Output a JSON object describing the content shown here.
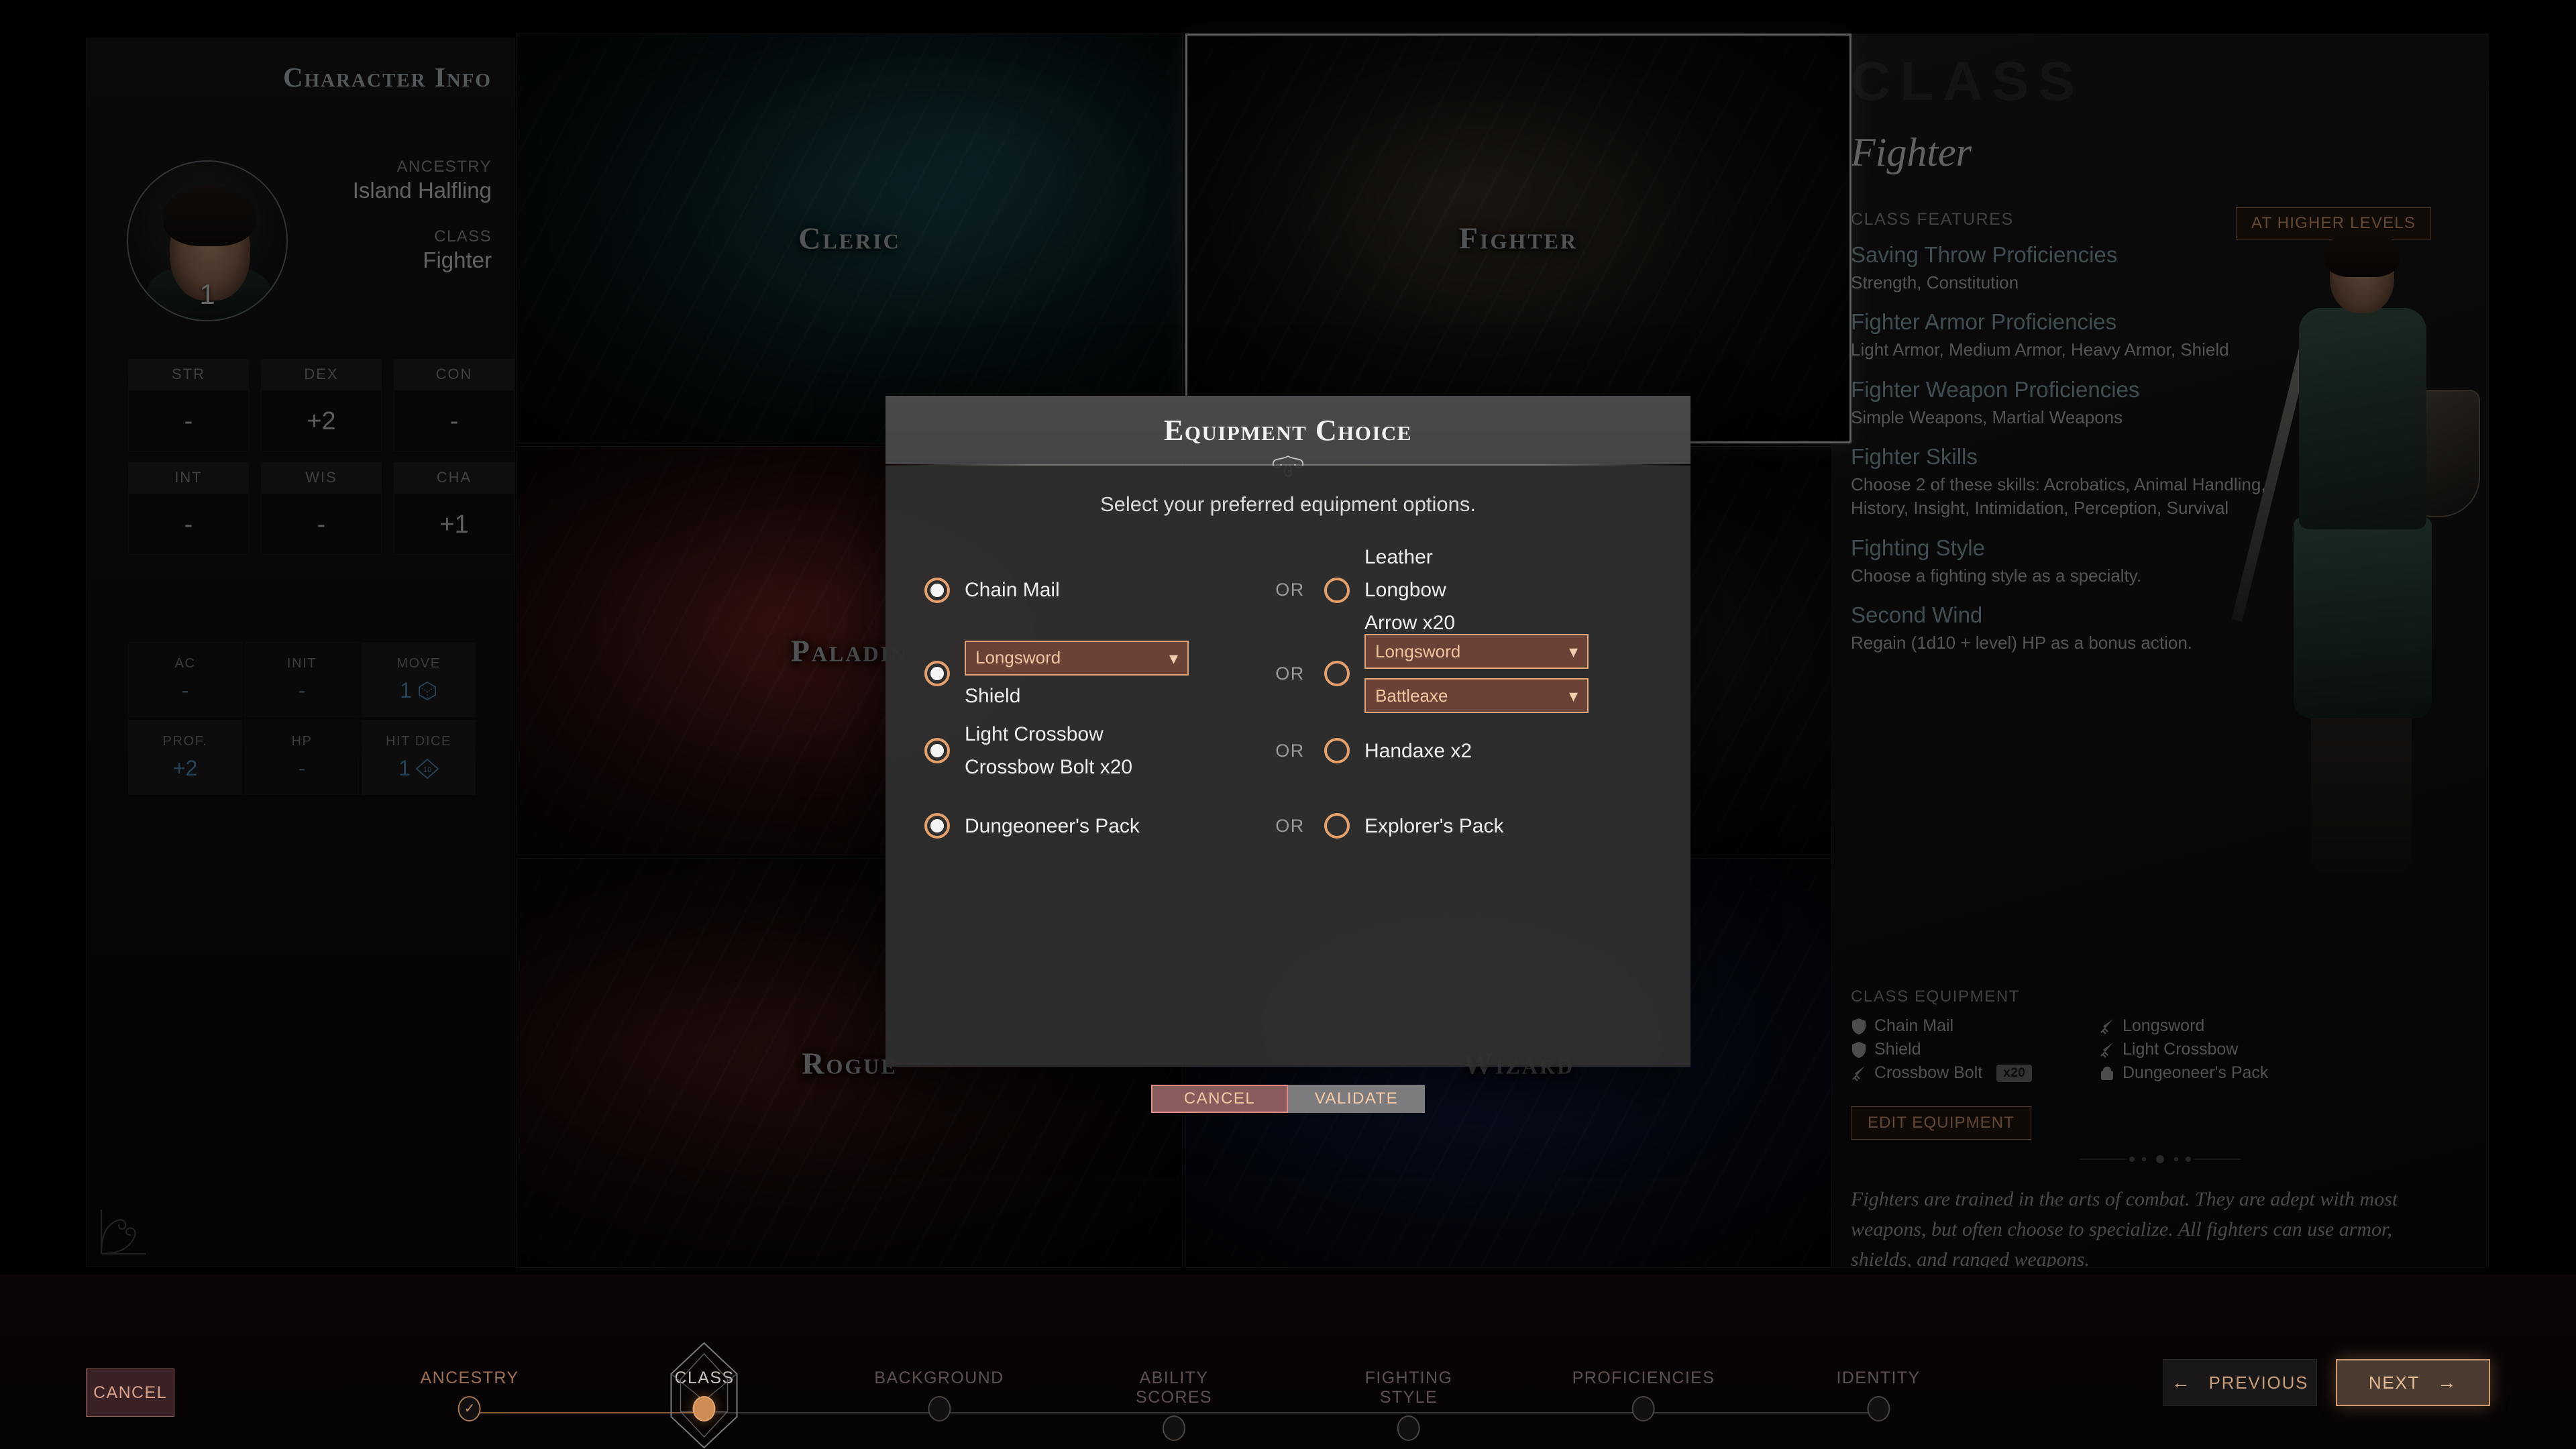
{
  "left_panel": {
    "heading": "Character Info",
    "portrait_level": "1",
    "ancestry_label": "ANCESTRY",
    "ancestry_value": "Island Halfling",
    "class_label": "CLASS",
    "class_value": "Fighter",
    "abilities": [
      {
        "name": "STR",
        "value": "-"
      },
      {
        "name": "DEX",
        "value": "+2"
      },
      {
        "name": "CON",
        "value": "-"
      },
      {
        "name": "INT",
        "value": "-"
      },
      {
        "name": "WIS",
        "value": "-"
      },
      {
        "name": "CHA",
        "value": "+1"
      }
    ],
    "derived": [
      {
        "name": "AC",
        "value": "-",
        "icon": "none",
        "highlight": false
      },
      {
        "name": "INIT",
        "value": "-",
        "icon": "none",
        "highlight": false
      },
      {
        "name": "MOVE",
        "value": "1",
        "icon": "cube",
        "highlight": true
      },
      {
        "name": "PROF.",
        "value": "+2",
        "icon": "none",
        "highlight": true
      },
      {
        "name": "HP",
        "value": "-",
        "icon": "none",
        "highlight": false
      },
      {
        "name": "HIT DICE",
        "value": "1",
        "icon": "d10",
        "highlight": true
      }
    ]
  },
  "class_grid": {
    "cards": [
      {
        "label": "Cleric",
        "key": "cleric",
        "selected": false
      },
      {
        "label": "Fighter",
        "key": "fighter",
        "selected": true
      },
      {
        "label": "Paladin",
        "key": "paladin",
        "selected": false
      },
      {
        "label": "",
        "key": "ranger",
        "selected": false
      },
      {
        "label": "Rogue",
        "key": "rogue",
        "selected": false
      },
      {
        "label": "Wizard",
        "key": "wizard",
        "selected": false
      }
    ]
  },
  "right_panel": {
    "ghost_title": "CLASS",
    "class_name": "Fighter",
    "features_heading": "CLASS FEATURES",
    "higher_levels_button": "AT HIGHER LEVELS",
    "features": [
      {
        "title": "Saving Throw Proficiencies",
        "body": "Strength, Constitution"
      },
      {
        "title": "Fighter Armor Proficiencies",
        "body": "Light Armor, Medium Armor, Heavy Armor, Shield"
      },
      {
        "title": "Fighter Weapon Proficiencies",
        "body": "Simple Weapons, Martial Weapons"
      },
      {
        "title": "Fighter Skills",
        "body": "Choose 2 of these skills: Acrobatics, Animal Handling, History, Insight, Intimidation, Perception, Survival"
      },
      {
        "title": "Fighting Style",
        "body": "Choose a fighting style as a specialty."
      },
      {
        "title": "Second Wind",
        "body": "Regain (1d10 + level) HP as a bonus action."
      }
    ],
    "equipment_heading": "CLASS EQUIPMENT",
    "equipment": [
      {
        "name": "Chain Mail",
        "icon": "shield-icon",
        "badge": ""
      },
      {
        "name": "Longsword",
        "icon": "sword-icon",
        "badge": ""
      },
      {
        "name": "Shield",
        "icon": "shield-icon",
        "badge": ""
      },
      {
        "name": "Light Crossbow",
        "icon": "sword-icon",
        "badge": ""
      },
      {
        "name": "Crossbow Bolt",
        "icon": "sword-icon",
        "badge": "x20"
      },
      {
        "name": "Dungeoneer's Pack",
        "icon": "pack-icon",
        "badge": ""
      }
    ],
    "edit_equipment_button": "EDIT EQUIPMENT",
    "description": "Fighters are trained in the arts of combat. They are adept with most weapons, but often choose to specialize. All fighters can use armor, shields, and ranged weapons."
  },
  "modal": {
    "title": "Equipment Choice",
    "subtitle": "Select your preferred equipment options.",
    "or_text": "OR",
    "rows": [
      {
        "left": {
          "selected": true,
          "labels": [
            "Chain Mail"
          ],
          "dropdowns": []
        },
        "right": {
          "selected": false,
          "labels": [
            "Leather",
            "Longbow",
            "Arrow x20"
          ],
          "dropdowns": []
        }
      },
      {
        "left": {
          "selected": true,
          "labels": [
            "Shield"
          ],
          "dropdowns": [
            "Longsword"
          ]
        },
        "right": {
          "selected": false,
          "labels": [],
          "dropdowns": [
            "Longsword",
            "Battleaxe"
          ]
        }
      },
      {
        "left": {
          "selected": true,
          "labels": [
            "Light Crossbow",
            "Crossbow Bolt x20"
          ],
          "dropdowns": []
        },
        "right": {
          "selected": false,
          "labels": [
            "Handaxe x2"
          ],
          "dropdowns": []
        }
      },
      {
        "left": {
          "selected": true,
          "labels": [
            "Dungeoneer's Pack"
          ],
          "dropdowns": []
        },
        "right": {
          "selected": false,
          "labels": [
            "Explorer's Pack"
          ],
          "dropdowns": []
        }
      }
    ],
    "cancel_button": "CANCEL",
    "validate_button": "VALIDATE"
  },
  "bottom_bar": {
    "cancel_button": "CANCEL",
    "previous_button": "PREVIOUS",
    "next_button": "NEXT",
    "steps": [
      {
        "label": "ANCESTRY",
        "state": "done"
      },
      {
        "label": "CLASS",
        "state": "current"
      },
      {
        "label": "BACKGROUND",
        "state": "todo"
      },
      {
        "label": "ABILITY\nSCORES",
        "state": "todo"
      },
      {
        "label": "FIGHTING\nSTYLE",
        "state": "todo"
      },
      {
        "label": "PROFICIENCIES",
        "state": "todo"
      },
      {
        "label": "IDENTITY",
        "state": "todo"
      }
    ]
  },
  "colors": {
    "accent": "#d09a6c",
    "accent_text": "#e5bd97",
    "radio_ring": "#e6a06c",
    "dropdown_bg": "#6a4336",
    "dropdown_border": "#e0a277",
    "cancel_bg": "#8a5b5d",
    "blue_stat": "#5896c4",
    "feature_title": "#8faab4"
  }
}
